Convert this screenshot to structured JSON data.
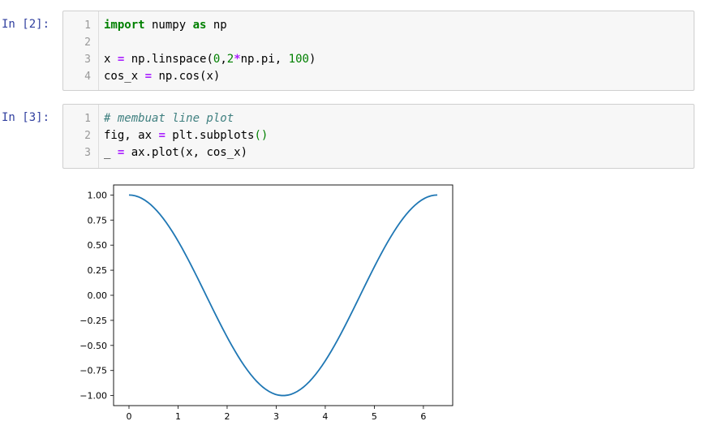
{
  "cells": [
    {
      "prompt": "In [2]:",
      "lines": [
        {
          "n": "1",
          "tokens": [
            {
              "t": "import",
              "c": "kw"
            },
            {
              "t": " numpy ",
              "c": "pn"
            },
            {
              "t": "as",
              "c": "kw"
            },
            {
              "t": " np",
              "c": "pn"
            }
          ]
        },
        {
          "n": "2",
          "tokens": []
        },
        {
          "n": "3",
          "tokens": [
            {
              "t": "x ",
              "c": "pn"
            },
            {
              "t": "=",
              "c": "op"
            },
            {
              "t": " np.linspace(",
              "c": "pn"
            },
            {
              "t": "0",
              "c": "num"
            },
            {
              "t": ",",
              "c": "pn"
            },
            {
              "t": "2",
              "c": "num"
            },
            {
              "t": "*",
              "c": "op"
            },
            {
              "t": "np.pi, ",
              "c": "pn"
            },
            {
              "t": "100",
              "c": "num"
            },
            {
              "t": ")",
              "c": "pn"
            }
          ]
        },
        {
          "n": "4",
          "tokens": [
            {
              "t": "cos_x ",
              "c": "pn"
            },
            {
              "t": "=",
              "c": "op"
            },
            {
              "t": " np.cos(x)",
              "c": "pn"
            }
          ]
        }
      ]
    },
    {
      "prompt": "In [3]:",
      "lines": [
        {
          "n": "1",
          "tokens": [
            {
              "t": "# membuat line plot",
              "c": "cm"
            }
          ]
        },
        {
          "n": "2",
          "tokens": [
            {
              "t": "fig, ax ",
              "c": "pn"
            },
            {
              "t": "=",
              "c": "op"
            },
            {
              "t": " plt.subplots",
              "c": "pn"
            },
            {
              "t": "()",
              "c": "num"
            }
          ]
        },
        {
          "n": "3",
          "tokens": [
            {
              "t": "_ ",
              "c": "pn"
            },
            {
              "t": "=",
              "c": "op"
            },
            {
              "t": " ax.plot(x, cos_x)",
              "c": "pn"
            }
          ]
        }
      ]
    }
  ],
  "chart_data": {
    "type": "line",
    "title": "",
    "xlabel": "",
    "ylabel": "",
    "xlim": [
      -0.314,
      6.597
    ],
    "ylim": [
      -1.1,
      1.1
    ],
    "xticks": [
      "0",
      "1",
      "2",
      "3",
      "4",
      "5",
      "6"
    ],
    "yticks": [
      "1.00",
      "0.75",
      "0.50",
      "0.25",
      "0.00",
      "−0.25",
      "−0.50",
      "−0.75",
      "−1.00"
    ],
    "series": [
      {
        "function": "cos(x)",
        "x_range": [
          0,
          6.283
        ],
        "points": 100,
        "color": "#1f77b4"
      }
    ],
    "grid": false,
    "legend": "none"
  }
}
